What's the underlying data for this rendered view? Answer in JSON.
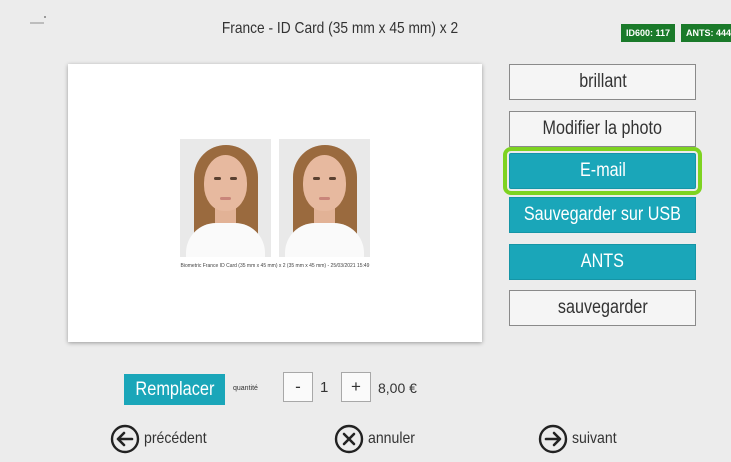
{
  "header": {
    "title": "France - ID Card (35 mm x 45 mm) x 2",
    "badges": [
      "ID600: 117",
      "ANTS: 444"
    ]
  },
  "preview": {
    "caption": "Biometric France ID Card (35 mm x 45 mm) x 2 (35 mm x 45 mm) - 25/03/2021 15:49"
  },
  "side_buttons": {
    "brillant": "brillant",
    "modify": "Modifier la photo",
    "email": "E-mail",
    "usb": "Sauvegarder sur USB",
    "ants": "ANTS",
    "save": "sauvegarder"
  },
  "order": {
    "replace_label": "Remplacer",
    "quantity_label": "quantité",
    "minus": "-",
    "quantity": "1",
    "plus": "+",
    "price": "8,00 €"
  },
  "nav": {
    "previous": "précédent",
    "cancel": "annuler",
    "next": "suivant"
  },
  "colors": {
    "accent": "#1aa6b9",
    "highlight": "#7ed321",
    "badge": "#1a7a2a"
  }
}
